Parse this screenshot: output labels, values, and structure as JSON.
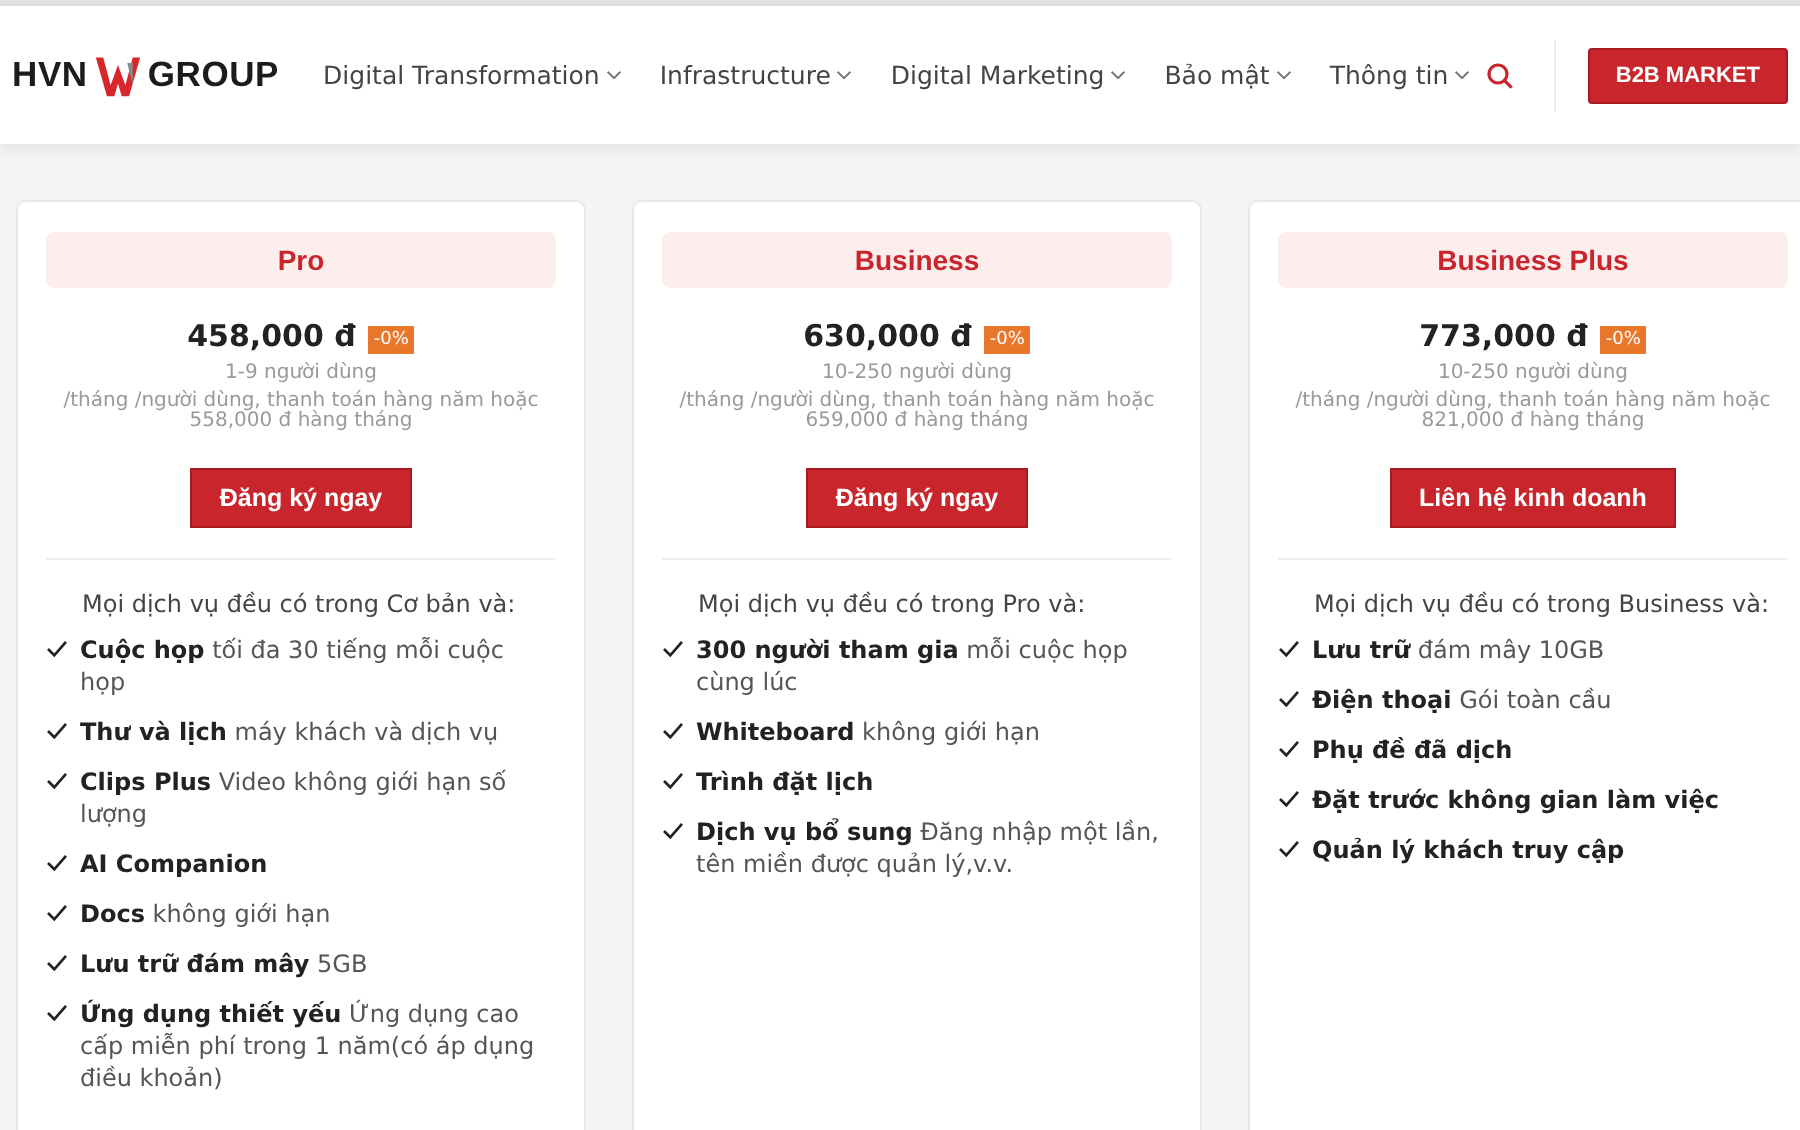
{
  "header": {
    "logo": {
      "left": "HVN",
      "right": "GROUP"
    },
    "nav": [
      {
        "label": "Digital Transformation"
      },
      {
        "label": "Infrastructure"
      },
      {
        "label": "Digital Marketing"
      },
      {
        "label": "Bảo mật"
      },
      {
        "label": "Thông tin"
      }
    ],
    "cta": "B2B MARKET"
  },
  "plans": [
    {
      "name": "Pro",
      "price": "458,000 đ",
      "discount": "-0%",
      "users": "1-9 người dùng",
      "billing": "/tháng /người dùng, thanh toán hàng năm hoặc 558,000 đ hàng tháng",
      "button": "Đăng ký ngay",
      "intro": "Mọi dịch vụ đều có trong Cơ bản và:",
      "features": [
        {
          "title": "Cuộc họp",
          "text": "tối đa 30 tiếng mỗi cuộc họp"
        },
        {
          "title": "Thư và lịch",
          "text": "máy khách và dịch vụ"
        },
        {
          "title": "Clips Plus",
          "text": "Video không giới hạn số lượng"
        },
        {
          "title": "AI Companion"
        },
        {
          "title": "Docs",
          "text": "không giới hạn"
        },
        {
          "title": "Lưu trữ đám mây",
          "text": "5GB"
        },
        {
          "title": "Ứng dụng thiết yếu",
          "text": "Ứng dụng cao cấp miễn phí trong 1 năm(có áp dụng điều khoản)"
        }
      ]
    },
    {
      "name": "Business",
      "price": "630,000 đ",
      "discount": "-0%",
      "users": "10-250 người dùng",
      "billing": "/tháng /người dùng, thanh toán hàng năm hoặc 659,000 đ hàng tháng",
      "button": "Đăng ký ngay",
      "intro": "Mọi dịch vụ đều có trong Pro và:",
      "features": [
        {
          "title": "300 người tham gia",
          "text": "mỗi cuộc họp cùng lúc"
        },
        {
          "title": "Whiteboard",
          "text": "không giới hạn"
        },
        {
          "title": "Trình đặt lịch"
        },
        {
          "title": "Dịch vụ bổ sung",
          "text": "Đăng nhập một lần, tên miền được quản lý,v.v."
        }
      ]
    },
    {
      "name": "Business Plus",
      "price": "773,000 đ",
      "discount": "-0%",
      "users": "10-250 người dùng",
      "billing": "/tháng /người dùng, thanh toán hàng năm hoặc 821,000 đ hàng tháng",
      "button": "Liên hệ kinh doanh",
      "intro": "Mọi dịch vụ đều có trong Business và:",
      "features": [
        {
          "title": "Lưu trữ",
          "text": "đám mây 10GB"
        },
        {
          "title": "Điện thoại",
          "text": "Gói toàn cầu"
        },
        {
          "title": "Phụ đề đã dịch"
        },
        {
          "title": "Đặt trước không gian làm việc"
        },
        {
          "title": "Quản lý khách truy cập"
        }
      ]
    }
  ]
}
